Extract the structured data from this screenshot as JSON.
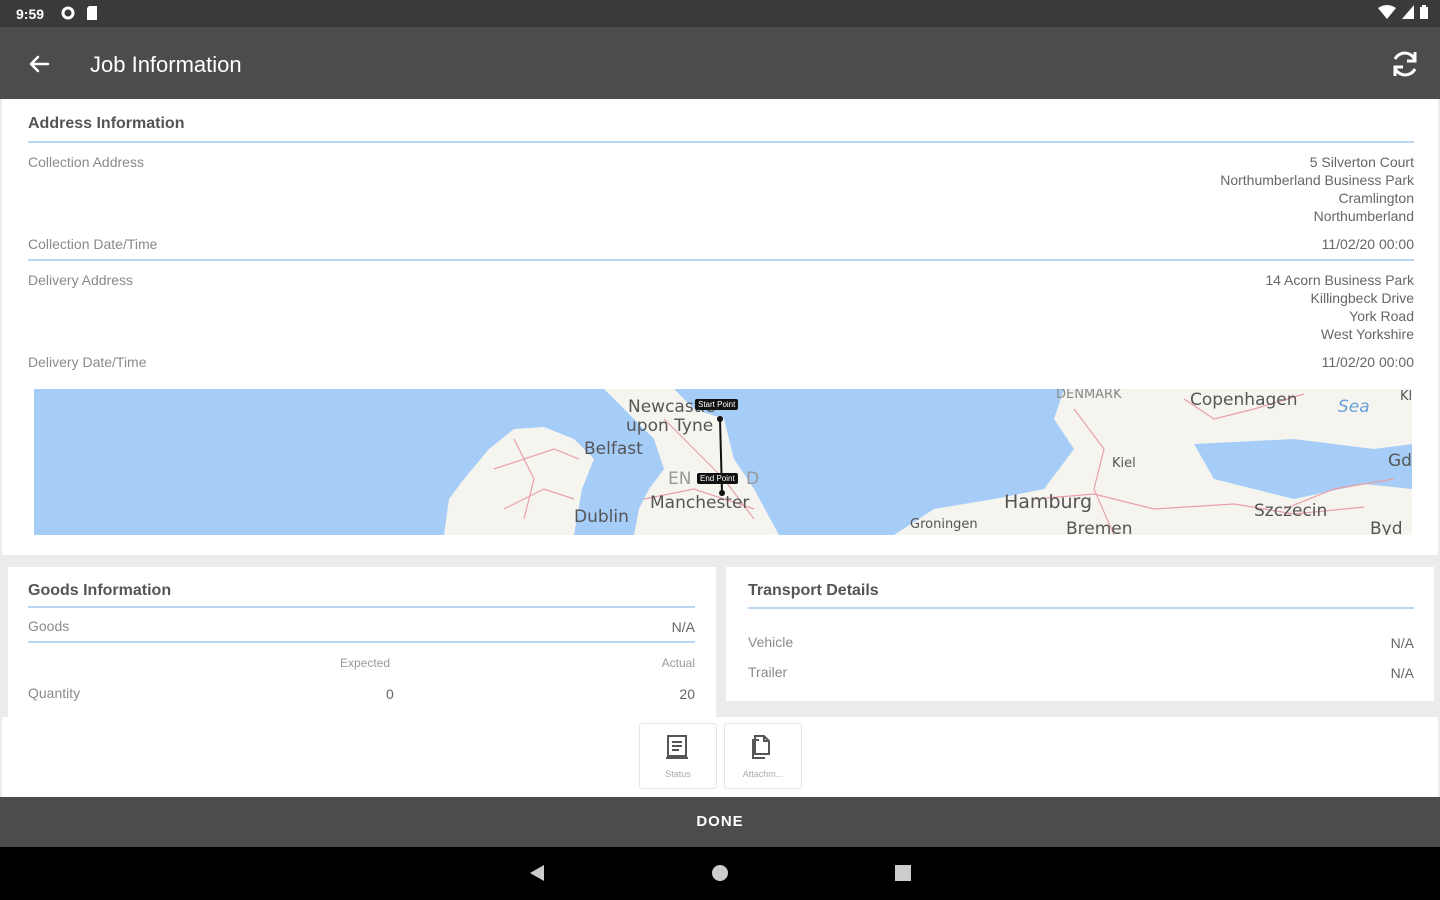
{
  "status_bar": {
    "time": "9:59",
    "icons_left": [
      "settings-icon",
      "sd-card-icon"
    ],
    "icons_right": [
      "wifi-icon",
      "signal-icon",
      "battery-icon"
    ]
  },
  "app_bar": {
    "title": "Job Information",
    "back_icon": "arrow-left-icon",
    "refresh_icon": "refresh-icon",
    "color": "#4c4c4c"
  },
  "address": {
    "title": "Address Information",
    "collection_address_label": "Collection Address",
    "collection_address_lines": [
      "5 Silverton Court",
      "Northumberland Business Park",
      "Cramlington",
      "Northumberland"
    ],
    "collection_datetime_label": "Collection Date/Time",
    "collection_datetime": "11/02/20 00:00",
    "delivery_address_label": "Delivery Address",
    "delivery_address_lines": [
      "14 Acorn Business Park",
      "Killingbeck Drive",
      "York Road",
      "West Yorkshire"
    ],
    "delivery_datetime_label": "Delivery Date/Time",
    "delivery_datetime": "11/02/20 00:00"
  },
  "map": {
    "start_label": "Start Point",
    "end_label": "End Point",
    "places": [
      "Newcastle",
      "upon Tyne",
      "Belfast",
      "Dublin",
      "Manchester",
      "EN",
      "D",
      "DENMARK",
      "Copenhagen",
      "Sea",
      "Kiel",
      "Hamburg",
      "Bremen",
      "Groningen",
      "Szczecin",
      "Gd",
      "Byd",
      "Kl"
    ]
  },
  "goods": {
    "title": "Goods Information",
    "goods_label": "Goods",
    "goods_value": "N/A",
    "expected_label": "Expected",
    "actual_label": "Actual",
    "quantity_label": "Quantity",
    "quantity_expected": "0",
    "quantity_actual": "20"
  },
  "transport": {
    "title": "Transport Details",
    "vehicle_label": "Vehicle",
    "vehicle_value": "N/A",
    "trailer_label": "Trailer",
    "trailer_value": "N/A"
  },
  "toolbar": {
    "status_label": "Status",
    "attachments_label": "Attachm..."
  },
  "done_label": "DONE"
}
